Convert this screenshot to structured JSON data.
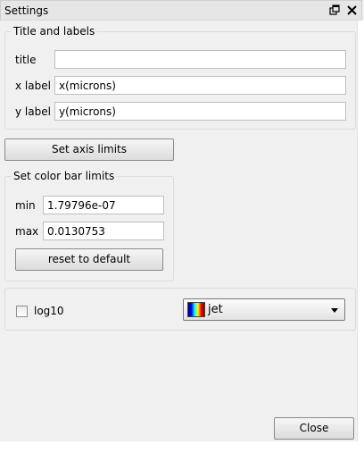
{
  "window": {
    "title": "Settings"
  },
  "titles_group": {
    "label": "Title and labels",
    "title_label": "title",
    "title_value": "",
    "xlabel_label": "x label",
    "xlabel_value": "x(microns)",
    "ylabel_label": "y label",
    "ylabel_value": "y(microns)"
  },
  "axis_button": {
    "label": "Set axis limits"
  },
  "colorbar_group": {
    "label": "Set color bar limits",
    "min_label": "min",
    "min_value": "1.79796e-07",
    "max_label": "max",
    "max_value": "0.0130753",
    "reset_label": "reset to default"
  },
  "options": {
    "log10_label": "log10",
    "log10_checked": false,
    "colormap_value": "jet"
  },
  "close_button": {
    "label": "Close"
  },
  "icons": {
    "float": "float-window-icon",
    "close": "close-icon",
    "colormap_swatch": "jet-colormap-swatch",
    "dropdown": "chevron-down-icon"
  }
}
